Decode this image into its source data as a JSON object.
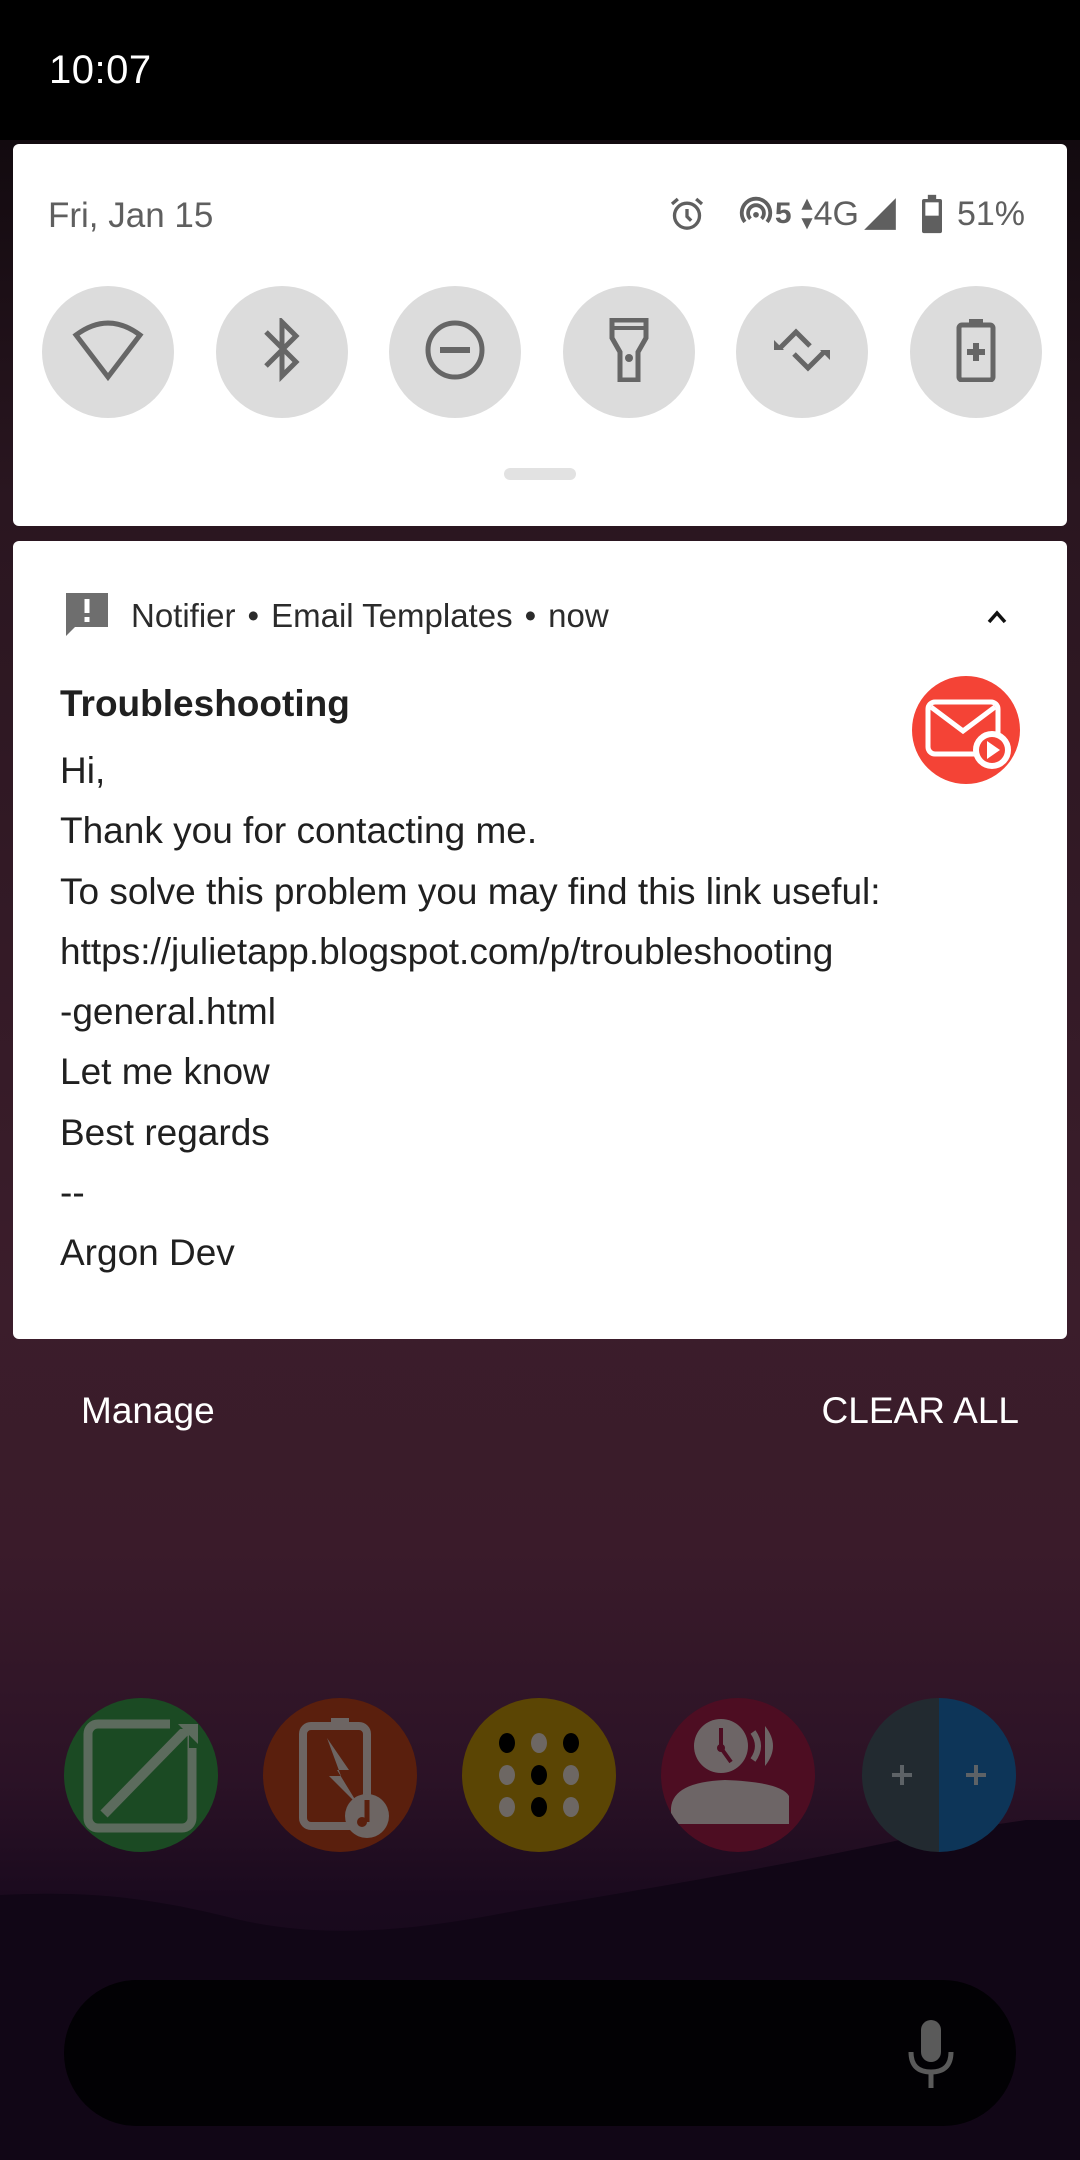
{
  "status_bar": {
    "time": "10:07"
  },
  "quick_settings": {
    "date": "Fri, Jan 15",
    "status_icons": [
      "alarm-icon",
      "hotspot-icon",
      "data-activity-icon",
      "cell-signal-icon",
      "battery-icon"
    ],
    "hotspot_count": "5",
    "network_type": "4G",
    "battery_percent": "51%",
    "tiles": [
      {
        "name": "wifi",
        "icon": "wifi-icon",
        "active": false
      },
      {
        "name": "bluetooth",
        "icon": "bluetooth-icon",
        "active": false
      },
      {
        "name": "do-not-disturb",
        "icon": "do-not-disturb-icon",
        "active": false
      },
      {
        "name": "flashlight",
        "icon": "flashlight-icon",
        "active": false
      },
      {
        "name": "auto-rotate",
        "icon": "auto-rotate-icon",
        "active": false
      },
      {
        "name": "battery-saver",
        "icon": "battery-saver-icon",
        "active": false
      }
    ]
  },
  "notification": {
    "app_name": "Notifier",
    "separator": "•",
    "channel": "Email Templates",
    "time": "now",
    "title": "Troubleshooting",
    "body_lines": [
      "Hi,",
      "Thank you for contacting me.",
      "To solve this problem you may find this link useful:",
      "https://julietapp.blogspot.com/p/troubleshooting",
      "-general.html",
      "Let me know",
      "Best regards",
      "--",
      "Argon Dev"
    ],
    "accent_color": "#f44336"
  },
  "footer": {
    "manage_label": "Manage",
    "clear_all_label": "CLEAR ALL"
  },
  "dock": {
    "apps": [
      {
        "icon": "edit-tile-icon",
        "color": "#1b4a23"
      },
      {
        "icon": "battery-sound-icon",
        "color": "#5a1f0d"
      },
      {
        "icon": "dots-grid-icon",
        "color": "#5b4504"
      },
      {
        "icon": "alarm-speaker-icon",
        "color": "#4d0d22"
      },
      {
        "icon": "dual-plus-icon",
        "color_left": "#222a30",
        "color_right": "#0d3558"
      }
    ]
  }
}
